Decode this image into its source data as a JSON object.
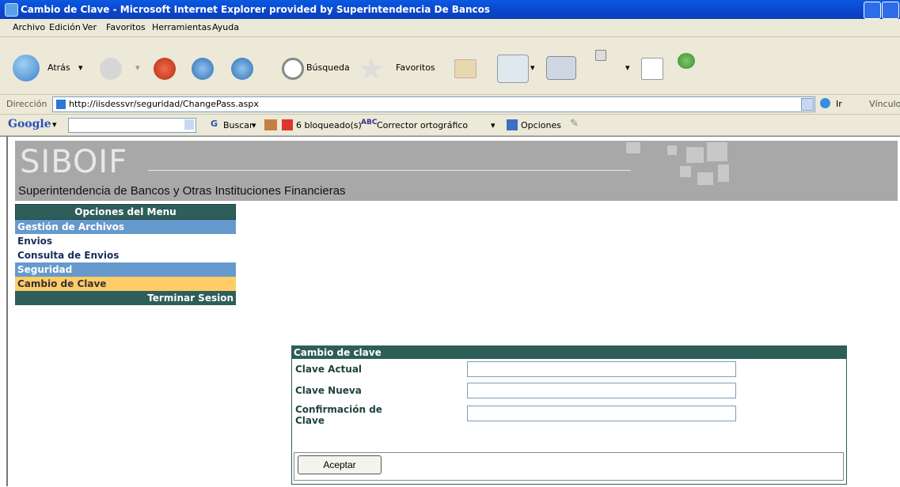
{
  "window": {
    "title": "Cambio de Clave - Microsoft Internet Explorer provided by Superintendencia De Bancos"
  },
  "menubar": [
    "Archivo",
    "Edición",
    "Ver",
    "Favoritos",
    "Herramientas",
    "Ayuda"
  ],
  "toolbar": {
    "back": "Atrás",
    "search": "Búsqueda",
    "favorites": "Favoritos"
  },
  "address": {
    "label": "Dirección",
    "url": "http://iisdessvr/seguridad/ChangePass.aspx",
    "go": "Ir",
    "links": "Vínculos"
  },
  "google": {
    "logo": "Google",
    "search": "Buscar",
    "blocked": "6 bloqueado(s)",
    "spell": "Corrector ortográfico",
    "options": "Opciones"
  },
  "banner": {
    "logo": "SIBOIF",
    "subtitle": "Superintendencia de Bancos y Otras Instituciones Financieras"
  },
  "menu": {
    "header": "Opciones del Menu",
    "category1": "Gestión de Archivos",
    "item1": "Envios",
    "item2": "Consulta de Envios",
    "category2": "Seguridad",
    "active": "Cambio de Clave",
    "logout": "Terminar Sesion"
  },
  "form": {
    "title": "Cambio de clave",
    "current": "Clave Actual",
    "new": "Clave Nueva",
    "confirm": "Confirmación de Clave",
    "submit": "Aceptar"
  },
  "colors": {
    "header": "#2e5e5a",
    "category": "#6699cc",
    "active": "#ffcc66"
  }
}
